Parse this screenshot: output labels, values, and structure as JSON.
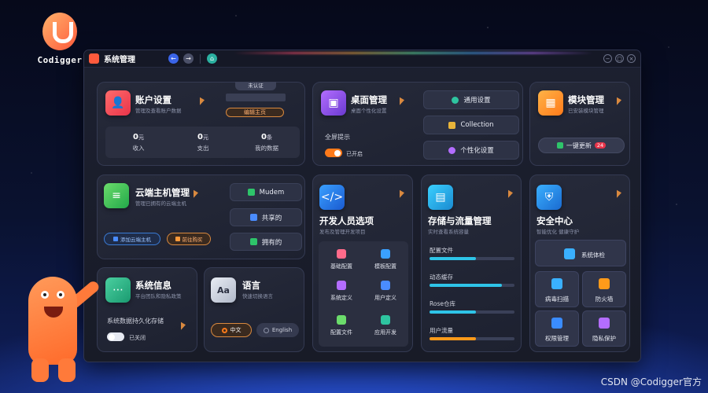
{
  "brand": {
    "name": "Codigger"
  },
  "window": {
    "title": "系统管理",
    "back_icon": "←",
    "forward_icon": "→",
    "home_icon": "⌂",
    "min": "−",
    "max": "□",
    "close": "×"
  },
  "account": {
    "title": "账户设置",
    "subtitle": "管理及查看账户数据",
    "badge": "未认证",
    "edit_label": "编辑主页",
    "stats": [
      {
        "value": "0",
        "unit": "元",
        "label": "收入"
      },
      {
        "value": "0",
        "unit": "元",
        "label": "支出"
      },
      {
        "value": "0",
        "unit": "条",
        "label": "我的数据"
      }
    ]
  },
  "desktop": {
    "title": "桌面管理",
    "subtitle": "桌面个性化设置",
    "fullscreen_label": "全屏提示",
    "toggle_state": "已开启",
    "options": [
      "通用设置",
      "Collection",
      "个性化设置"
    ]
  },
  "module": {
    "title": "模块管理",
    "subtitle": "已安装模块管理",
    "update_label": "一键更新",
    "update_count": "24"
  },
  "cloud": {
    "title": "云端主机管理",
    "subtitle": "管理已拥有的云端主机",
    "hosts": [
      "Mudem",
      "共享的",
      "拥有的"
    ],
    "add_label": "添加云端主机",
    "buy_label": "前往购买"
  },
  "developer": {
    "title": "开发人员选项",
    "subtitle": "发布及管理开发项目",
    "items": [
      "基础配置",
      "模板配置",
      "系统定义",
      "用户定义",
      "配置文件",
      "应用开发"
    ]
  },
  "storage": {
    "title": "存储与流量管理",
    "subtitle": "实时查看系统容量",
    "items": [
      {
        "label": "配置文件",
        "fraction": 0.55,
        "color": "#2ec4e8"
      },
      {
        "label": "动态缓存",
        "fraction": 0.85,
        "color": "#2ec4e8"
      },
      {
        "label": "Rose仓库",
        "fraction": 0.55,
        "color": "#2ec4e8"
      },
      {
        "label": "用户流量",
        "fraction": 0.55,
        "color": "#ff9a1a"
      }
    ]
  },
  "security": {
    "title": "安全中心",
    "subtitle": "智能优化 健康守护",
    "check_label": "系统体检",
    "buttons": [
      "病毒扫描",
      "防火墙",
      "权限管理",
      "隐私保护"
    ]
  },
  "sysinfo": {
    "title": "系统信息",
    "subtitle": "平台团队和隐私政策",
    "persist_label": "系统数据持久化存储",
    "toggle_state": "已关闭"
  },
  "language": {
    "title": "语言",
    "subtitle": "快速切换语言",
    "options": [
      "中文",
      "English"
    ]
  },
  "footer": {
    "text": "CSDN @Codigger官方"
  }
}
